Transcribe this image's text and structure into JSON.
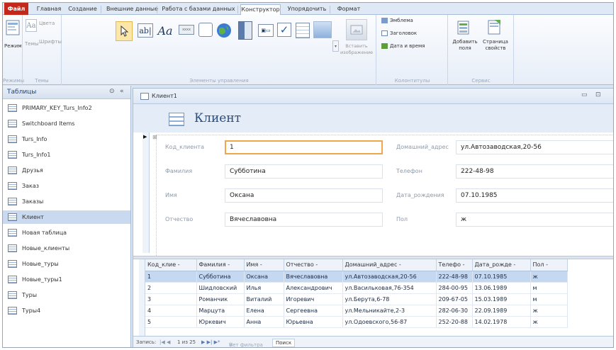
{
  "ribbon_tabs": [
    "Файл",
    "Главная",
    "Создание",
    "Внешние данные",
    "Работа с базами данных",
    "Конструктор",
    "Упорядочить",
    "Формат"
  ],
  "ribbon": {
    "views": {
      "button": "Режим",
      "group": "Режимы"
    },
    "themes": {
      "themes_button": "Темы",
      "colors": "Цвета",
      "fonts": "Шрифты",
      "group": "Темы"
    },
    "controls_group": "Элементы управления",
    "insert_image": "Вставить изображение",
    "header_footer": {
      "logo": "Эмблема",
      "title": "Заголовок",
      "datetime": "Дата и время",
      "group": "Колонтитулы"
    },
    "tools": {
      "add_fields": "Добавить поля",
      "property_sheet": "Страница свойств",
      "group": "Сервис"
    }
  },
  "nav": {
    "title": "Таблицы",
    "items": [
      "PRIMARY_KEY_Turs_Info2",
      "Switchboard Items",
      "Turs_Info",
      "Turs_Info1",
      "Друзья",
      "Заказ",
      "Заказы",
      "Клиент",
      "Новая таблица",
      "Новые_клиенты",
      "Новые_туры",
      "Новые_туры1",
      "Туры",
      "Туры4"
    ],
    "selected": "Клиент"
  },
  "document": {
    "tab_title": "Клиент1",
    "form_title": "Клиент",
    "fields": {
      "client_id": {
        "label": "Код_клиента",
        "value": "1"
      },
      "surname": {
        "label": "Фамилия",
        "value": "Субботина"
      },
      "name": {
        "label": "Имя",
        "value": "Оксана"
      },
      "patronymic": {
        "label": "Отчество",
        "value": "Вячеславовна"
      },
      "address": {
        "label": "Домашний_адрес",
        "value": "ул.Автозаводская,20-56"
      },
      "phone": {
        "label": "Телефон",
        "value": "222-48-98"
      },
      "birthdate": {
        "label": "Дата_рождения",
        "value": "07.10.1985"
      },
      "gender": {
        "label": "Пол",
        "value": "ж"
      }
    }
  },
  "datasheet": {
    "columns": [
      "Код_клие -",
      "Фамилия -",
      "Имя -",
      "Отчество -",
      "Домашний_адрес -",
      "Телефо -",
      "Дата_рожде -",
      "Пол -"
    ],
    "rows": [
      [
        "1",
        "Субботина",
        "Оксана",
        "Вячеславовна",
        "ул.Автозаводская,20-56",
        "222-48-98",
        "07.10.1985",
        "ж"
      ],
      [
        "2",
        "Шидловский",
        "Илья",
        "Александрович",
        "ул.Васильковая,76-354",
        "284-00-95",
        "13.06.1989",
        "м"
      ],
      [
        "3",
        "Романчик",
        "Виталий",
        "Игоревич",
        "ул.Берута,6-78",
        "209-67-05",
        "15.03.1989",
        "м"
      ],
      [
        "4",
        "Марцута",
        "Елена",
        "Сергеевна",
        "ул.Мельникайте,2-3",
        "282-06-30",
        "22.09.1989",
        "ж"
      ],
      [
        "5",
        "Юркевич",
        "Анна",
        "Юрьевна",
        "ул.Одоевского,56-87",
        "252-20-88",
        "14.02.1978",
        "ж"
      ]
    ],
    "selected_row": 0
  },
  "record_nav": {
    "label": "Запись:",
    "position": "1 из 25",
    "filter": "Нет фильтра",
    "search": "Поиск"
  },
  "colors": {
    "file_tab": "#c4281b",
    "selection": "#c4d8f2",
    "focus_border": "#f0a64a"
  }
}
